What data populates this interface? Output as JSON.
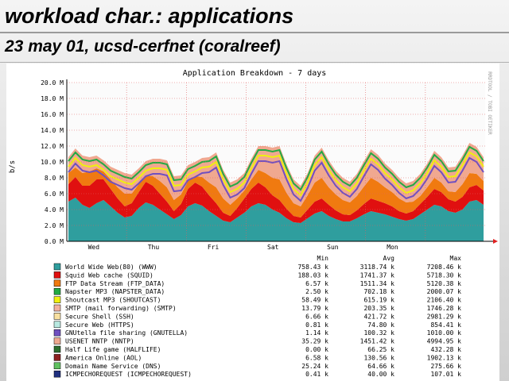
{
  "slide": {
    "title": "workload char.: applications",
    "subtitle": "23 may 01, ucsd-cerfnet (coralreef)"
  },
  "chart_data": {
    "type": "area",
    "title": "Application Breakdown - 7 days",
    "ylabel": "b/s",
    "watermark": "RRDTOOL / TOBI OETIKER",
    "ylim": [
      0,
      20
    ],
    "y_unit": "M",
    "yticks": [
      "0.0 M",
      "2.0 M",
      "4.0 M",
      "6.0 M",
      "8.0 M",
      "10.0 M",
      "12.0 M",
      "14.0 M",
      "16.0 M",
      "18.0 M",
      "20.0 M"
    ],
    "day_labels": [
      "Wed",
      "Thu",
      "Fri",
      "Sat",
      "Sun",
      "Mon"
    ],
    "grid": true,
    "stat_headers": [
      "Min",
      "Avg",
      "Max"
    ],
    "legend": [
      {
        "label": "World Wide Web(80) (WWW)",
        "color": "#2f9e9e",
        "min": "758.43 k",
        "avg": "3118.74 k",
        "max": "7208.46 k"
      },
      {
        "label": "Squid Web cache (SQUID)",
        "color": "#e01010",
        "min": "188.03 k",
        "avg": "1741.37 k",
        "max": "5718.30 k"
      },
      {
        "label": "FTP Data Stream (FTP_DATA)",
        "color": "#f07a10",
        "min": "6.57 k",
        "avg": "1511.34 k",
        "max": "5120.38 k"
      },
      {
        "label": "Napster MP3 (NAPSTER_DATA)",
        "color": "#22aa44",
        "min": "2.50 k",
        "avg": "702.18 k",
        "max": "2000.07 k"
      },
      {
        "label": "Shoutcast MP3 (SHOUTCAST)",
        "color": "#f0f010",
        "min": "58.49 k",
        "avg": "615.19 k",
        "max": "2106.40 k"
      },
      {
        "label": "SMTP (mail forwarding) (SMTP)",
        "color": "#f0b0a0",
        "min": "13.79 k",
        "avg": "203.35 k",
        "max": "1746.28 k"
      },
      {
        "label": "Secure Shell (SSH)",
        "color": "#f8e0a0",
        "min": "6.66 k",
        "avg": "421.72 k",
        "max": "2981.29 k"
      },
      {
        "label": "Secure Web (HTTPS)",
        "color": "#b8e8e0",
        "min": "0.81 k",
        "avg": "74.80 k",
        "max": "854.41 k"
      },
      {
        "label": "GNUtella file sharing (GNUTELLA)",
        "color": "#7050c0",
        "min": "1.14 k",
        "avg": "100.32 k",
        "max": "1010.00 k"
      },
      {
        "label": "USENET NNTP (NNTP)",
        "color": "#f0a890",
        "min": "35.29 k",
        "avg": "1451.42 k",
        "max": "4994.95 k"
      },
      {
        "label": "Half Life game (HALFLIFE)",
        "color": "#2e6e2e",
        "min": "0.00 k",
        "avg": "66.25 k",
        "max": "432.28 k"
      },
      {
        "label": "America Online (AOL)",
        "color": "#8e2020",
        "min": "6.58 k",
        "avg": "130.56 k",
        "max": "1902.13 k"
      },
      {
        "label": "Domain Name Service (DNS)",
        "color": "#60c060",
        "min": "25.24 k",
        "avg": "64.66 k",
        "max": "275.66 k"
      },
      {
        "label": "ICMPECHOREQUEST (ICMPECHOREQUEST)",
        "color": "#203080",
        "min": "0.41 k",
        "avg": "40.00 k",
        "max": "107.01 k"
      }
    ],
    "series_totals_M": {
      "description_key": "approximate stacked profile (M b/s), sampled evenly across the 7 days",
      "www": [
        5.0,
        5.5,
        4.6,
        4.2,
        4.8,
        5.2,
        4.4,
        3.6,
        3.0,
        3.2,
        4.2,
        4.9,
        4.6,
        4.0,
        3.4,
        2.8,
        3.3,
        4.4,
        4.8,
        4.5,
        3.8,
        3.2,
        2.6,
        2.4,
        3.0,
        3.6,
        4.4,
        4.8,
        4.6,
        4.0,
        3.6,
        2.9,
        2.4,
        2.3,
        2.9,
        3.5,
        3.8,
        3.2,
        2.8,
        2.5,
        2.5,
        2.9,
        3.4,
        3.8,
        3.6,
        3.4,
        3.1,
        2.8,
        2.6,
        2.8,
        3.4,
        4.0,
        4.6,
        4.4,
        3.8,
        3.6,
        4.0,
        5.0,
        5.2,
        4.6
      ],
      "squid": [
        2.2,
        2.6,
        2.4,
        2.8,
        3.0,
        2.6,
        2.2,
        1.8,
        1.4,
        1.6,
        2.0,
        2.6,
        2.4,
        2.0,
        1.6,
        1.0,
        1.4,
        2.2,
        2.6,
        2.4,
        2.0,
        1.6,
        1.0,
        0.8,
        1.2,
        1.8,
        2.2,
        2.6,
        2.2,
        1.8,
        1.6,
        1.2,
        0.8,
        0.7,
        1.1,
        1.5,
        1.6,
        1.4,
        1.1,
        0.9,
        0.8,
        1.0,
        1.3,
        1.6,
        1.5,
        1.4,
        1.3,
        1.0,
        0.9,
        1.0,
        1.3,
        1.6,
        2.0,
        1.8,
        1.5,
        1.4,
        1.6,
        1.8,
        1.9,
        1.8
      ],
      "ftp": [
        1.4,
        1.2,
        1.6,
        1.8,
        1.4,
        1.0,
        1.2,
        1.4,
        1.6,
        1.2,
        1.0,
        0.8,
        1.2,
        1.6,
        1.8,
        1.4,
        1.2,
        1.0,
        0.8,
        1.2,
        1.6,
        2.0,
        1.8,
        1.4,
        1.2,
        1.0,
        1.2,
        1.6,
        1.8,
        2.2,
        2.6,
        2.0,
        1.6,
        1.4,
        1.8,
        2.4,
        2.6,
        2.2,
        2.0,
        1.8,
        1.6,
        1.8,
        2.2,
        2.6,
        2.4,
        2.0,
        1.8,
        1.6,
        1.4,
        1.2,
        1.0,
        1.2,
        1.4,
        1.2,
        1.0,
        1.2,
        1.6,
        1.8,
        1.4,
        1.2
      ],
      "other": [
        2.0,
        2.4,
        2.2,
        1.8,
        1.6,
        1.4,
        1.6,
        2.2,
        2.6,
        2.4,
        2.0,
        1.8,
        2.2,
        2.8,
        3.4,
        3.0,
        2.4,
        2.0,
        1.8,
        2.4,
        3.2,
        4.4,
        3.6,
        2.8,
        2.4,
        2.2,
        2.6,
        3.0,
        3.4,
        3.8,
        4.2,
        3.6,
        3.0,
        2.6,
        2.8,
        3.4,
        3.8,
        3.4,
        3.0,
        2.8,
        2.6,
        2.8,
        3.2,
        3.6,
        3.4,
        3.0,
        2.8,
        2.6,
        2.4,
        2.6,
        2.8,
        3.0,
        3.4,
        3.2,
        3.0,
        3.2,
        3.6,
        3.8,
        3.4,
        3.0
      ]
    }
  }
}
